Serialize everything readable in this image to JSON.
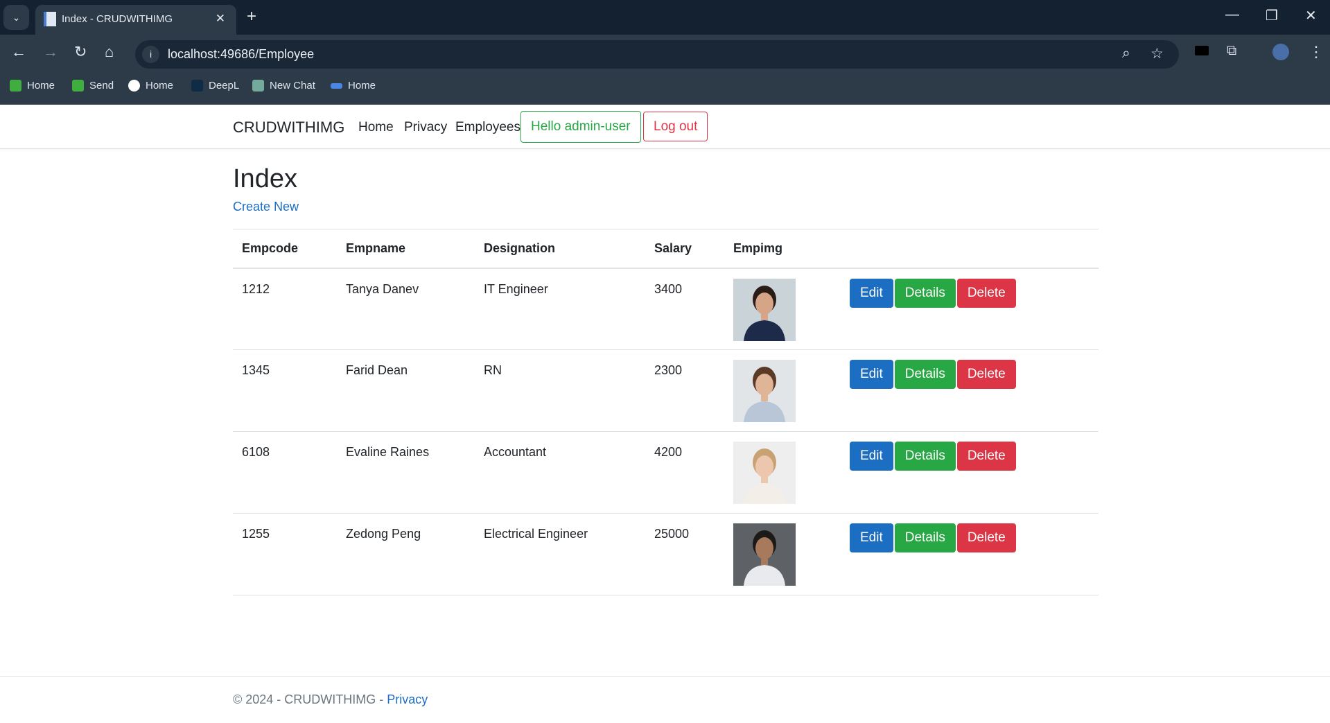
{
  "browser": {
    "tab_title": "Index - CRUDWITHIMG",
    "url": "localhost:49686/Employee",
    "bookmarks": [
      {
        "label": "Home",
        "color": "#3fae3f"
      },
      {
        "label": "Send",
        "color": "#3fae3f"
      },
      {
        "label": "Home",
        "color": "#ffffff"
      },
      {
        "label": "DeepL",
        "color": "#0f2b46"
      },
      {
        "label": "New Chat",
        "color": "#74aa9c"
      },
      {
        "label": "Home",
        "color": "#4a86e8"
      }
    ]
  },
  "nav": {
    "brand": "CRUDWITHIMG",
    "links": [
      "Home",
      "Privacy",
      "Employees"
    ],
    "hello": "Hello admin-user",
    "logout": "Log out"
  },
  "page": {
    "title": "Index",
    "create_new": "Create New",
    "headers": [
      "Empcode",
      "Empname",
      "Designation",
      "Salary",
      "Empimg"
    ],
    "actions": {
      "edit": "Edit",
      "details": "Details",
      "delete": "Delete"
    },
    "rows": [
      {
        "code": "1212",
        "name": "Tanya Danev",
        "designation": "IT Engineer",
        "salary": "3400",
        "photo": {
          "bg": "#c9d3d8",
          "hair": "#2a1c16",
          "skin": "#d6a587",
          "cloth": "#1d2a4a"
        }
      },
      {
        "code": "1345",
        "name": "Farid Dean",
        "designation": "RN",
        "salary": "2300",
        "photo": {
          "bg": "#e1e5e8",
          "hair": "#5a3a26",
          "skin": "#e0b497",
          "cloth": "#b8c6d8"
        }
      },
      {
        "code": "6108",
        "name": "Evaline Raines",
        "designation": "Accountant",
        "salary": "4200",
        "photo": {
          "bg": "#eeeeee",
          "hair": "#c9a274",
          "skin": "#ecc7ad",
          "cloth": "#f3efe8"
        }
      },
      {
        "code": "1255",
        "name": "Zedong Peng",
        "designation": "Electrical Engineer",
        "salary": "25000",
        "photo": {
          "bg": "#5e6165",
          "hair": "#1c1a18",
          "skin": "#a77a5d",
          "cloth": "#e8eaee"
        }
      }
    ]
  },
  "footer": {
    "text": "© 2024 - CRUDWITHIMG - ",
    "privacy": "Privacy"
  },
  "colors": {
    "primary": "#1b6ec2",
    "success": "#28a745",
    "danger": "#dc3545"
  }
}
